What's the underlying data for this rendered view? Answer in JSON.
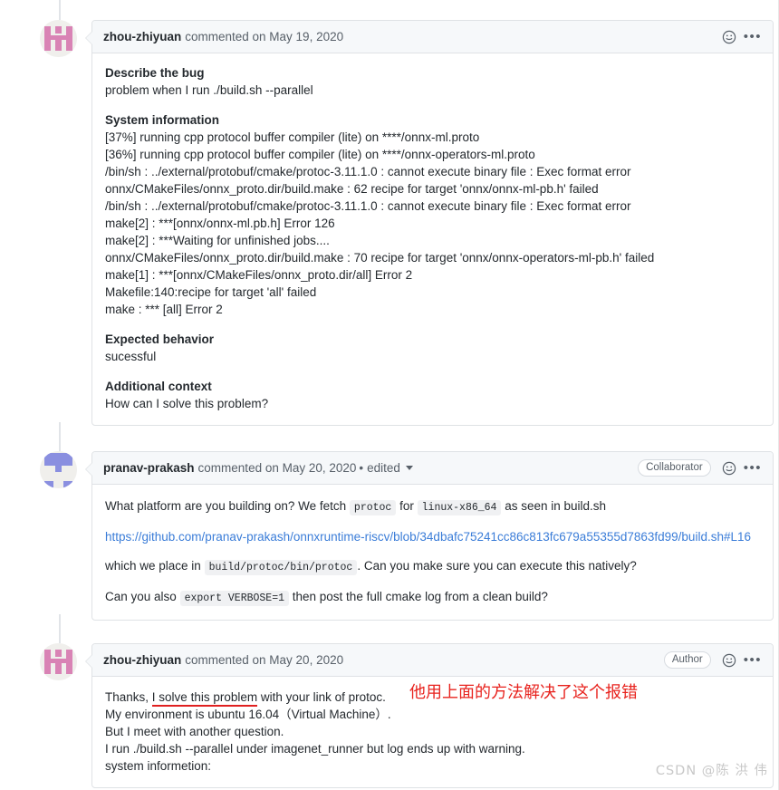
{
  "comments": [
    {
      "author": "zhou-zhiyuan",
      "meta": "commented on May 19, 2020",
      "edited": null,
      "badge": null,
      "avatar_color": "#d983b5",
      "reaction_icon": "smiley-icon",
      "menu_icon": "kebab-menu-icon",
      "body": {
        "section1_title": "Describe the bug",
        "section1_text": "problem when I run ./build.sh --parallel",
        "section2_title": "System information",
        "log_lines": [
          "[37%] running cpp protocol buffer compiler (lite) on ****/onnx-ml.proto",
          "[36%] running cpp protocol buffer compiler (lite) on ****/onnx-operators-ml.proto",
          "/bin/sh : ../external/protobuf/cmake/protoc-3.11.1.0 : cannot execute binary file : Exec format error",
          "onnx/CMakeFiles/onnx_proto.dir/build.make : 62 recipe for target 'onnx/onnx-ml-pb.h' failed",
          "/bin/sh : ../external/protobuf/cmake/protoc-3.11.1.0 : cannot execute binary file : Exec format error",
          "make[2] : ***[onnx/onnx-ml.pb.h] Error 126",
          "make[2] : ***Waiting for unfinished jobs....",
          "onnx/CMakeFiles/onnx_proto.dir/build.make : 70 recipe for target 'onnx/onnx-operators-ml-pb.h' failed",
          "make[1] : ***[onnx/CMakeFiles/onnx_proto.dir/all] Error 2",
          "Makefile:140:recipe for target 'all' failed",
          "make : *** [all] Error 2"
        ],
        "section3_title": "Expected behavior",
        "section3_text": "sucessful",
        "section4_title": "Additional context",
        "section4_text": "How can I solve this problem?"
      }
    },
    {
      "author": "pranav-prakash",
      "meta": "commented on May 20, 2020",
      "separator": "•",
      "edited": "edited",
      "badge": "Collaborator",
      "avatar_color": "#8a8fe0",
      "reaction_icon": "smiley-icon",
      "menu_icon": "kebab-menu-icon",
      "body": {
        "p1_a": "What platform are you building on? We fetch",
        "p1_code1": "protoc",
        "p1_b": "for",
        "p1_code2": "linux-x86_64",
        "p1_c": "as seen in build.sh",
        "link": "https://github.com/pranav-prakash/onnxruntime-riscv/blob/34dbafc75241cc86c813fc679a55355d7863fd99/build.sh#L16",
        "p2_a": "which we place in",
        "p2_code": "build/protoc/bin/protoc",
        "p2_b": ". Can you make sure you can execute this natively?",
        "p3_a": "Can you also",
        "p3_code": "export VERBOSE=1",
        "p3_b": "then post the full cmake log from a clean build?"
      }
    },
    {
      "author": "zhou-zhiyuan",
      "meta": "commented on May 20, 2020",
      "edited": null,
      "badge": "Author",
      "avatar_color": "#d983b5",
      "reaction_icon": "smiley-icon",
      "menu_icon": "kebab-menu-icon",
      "body": {
        "l1_a": "Thanks,",
        "l1_underlined": "I solve this problem",
        "l1_b": "with your link of protoc.",
        "l2": "My environment is ubuntu 16.04（Virtual Machine）.",
        "l3": "But I meet with another question.",
        "l4": "I run ./build.sh --parallel under imagenet_runner but log ends up with warning.",
        "l5": "system informetion:"
      }
    }
  ],
  "annotation": {
    "text": "他用上面的方法解决了这个报错",
    "color": "#e8231e"
  },
  "watermark": {
    "text": "CSDN @陈 洪 伟"
  }
}
